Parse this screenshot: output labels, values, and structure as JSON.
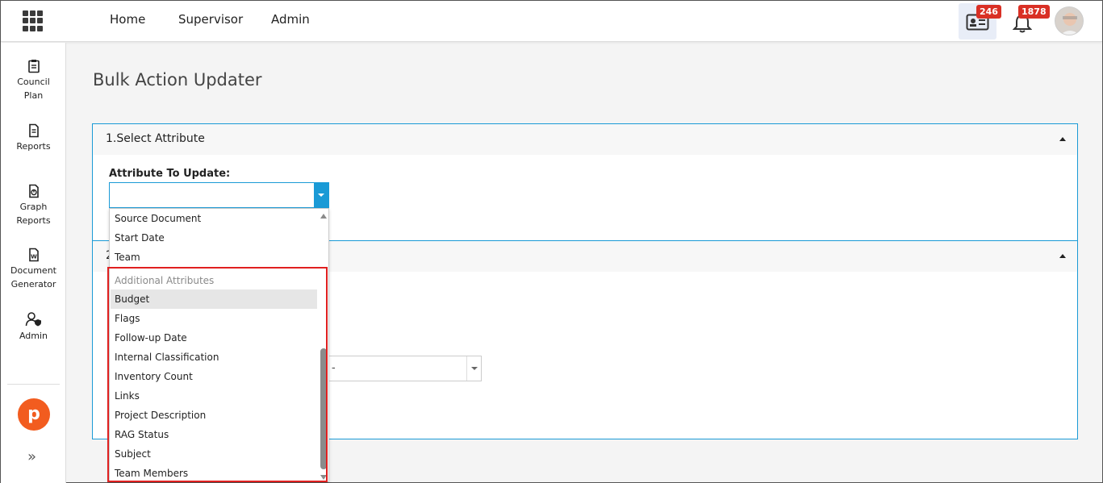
{
  "nav": {
    "links": [
      "Home",
      "Supervisor",
      "Admin"
    ],
    "contacts_badge": "246",
    "notifications_badge": "1878",
    "badge_color": "#d93025"
  },
  "sidebar": {
    "items": [
      {
        "label": "Council Plan",
        "icon": "clipboard-icon"
      },
      {
        "label": "Reports",
        "icon": "document-icon"
      },
      {
        "label": "Graph Reports",
        "icon": "chart-document-icon"
      },
      {
        "label": "Document Generator",
        "icon": "word-document-icon"
      },
      {
        "label": "Admin",
        "icon": "user-shield-icon"
      }
    ],
    "logo_letter": "p",
    "logo_color": "#f25c1f",
    "expand_glyph": "»"
  },
  "page": {
    "title": "Bulk Action Updater",
    "accent": "#1a9ad6"
  },
  "panel1": {
    "title": "1.Select Attribute",
    "field_label": "Attribute To Update:",
    "selected_value": ""
  },
  "panel2": {
    "title_prefix": "2",
    "select_value": "-"
  },
  "dropdown": {
    "items_top": [
      "Source Document",
      "Start Date",
      "Team"
    ],
    "group_label": "Additional Attributes",
    "items_group": [
      "Budget",
      "Flags",
      "Follow-up Date",
      "Internal Classification",
      "Inventory Count",
      "Links",
      "Project Description",
      "RAG Status",
      "Subject",
      "Team Members"
    ],
    "highlighted_item": "Budget"
  }
}
